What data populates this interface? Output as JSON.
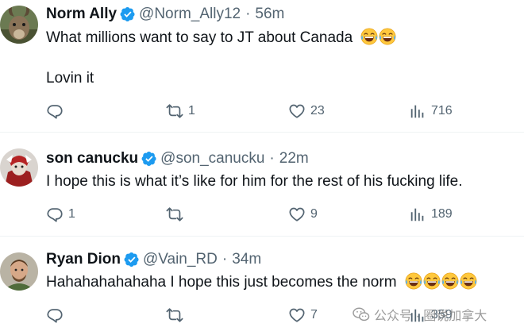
{
  "tweets": [
    {
      "name": "Norm Ally",
      "handle": "@Norm_Ally12",
      "separator": "·",
      "time": "56m",
      "text_lines": [
        "What millions want to say to JT about Canada",
        "",
        "Lovin it"
      ],
      "text_emojis": 2,
      "replies": "",
      "reposts": "1",
      "likes": "23",
      "views": "716",
      "avatar_icon": "goat-avatar"
    },
    {
      "name": "son canucku",
      "handle": "@son_canucku",
      "separator": "·",
      "time": "22m",
      "text_lines": [
        "I hope this is what it’s like for him for the rest of his fucking life."
      ],
      "text_emojis": 0,
      "replies": "1",
      "reposts": "",
      "likes": "9",
      "views": "189",
      "avatar_icon": "armored-character-avatar"
    },
    {
      "name": "Ryan Dion",
      "handle": "@Vain_RD",
      "separator": "·",
      "time": "34m",
      "text_lines": [
        "Hahahahahahaha I hope this just becomes the norm"
      ],
      "text_emojis": 4,
      "replies": "",
      "reposts": "",
      "likes": "7",
      "views": "359",
      "avatar_icon": "man-portrait-avatar"
    }
  ],
  "watermark": {
    "text": "公众号 · 圈说加拿大",
    "icon": "wechat-icon"
  },
  "colors": {
    "verified": "#1d9bf0",
    "secondary_text": "#536471",
    "separator": "#eff3f4"
  }
}
